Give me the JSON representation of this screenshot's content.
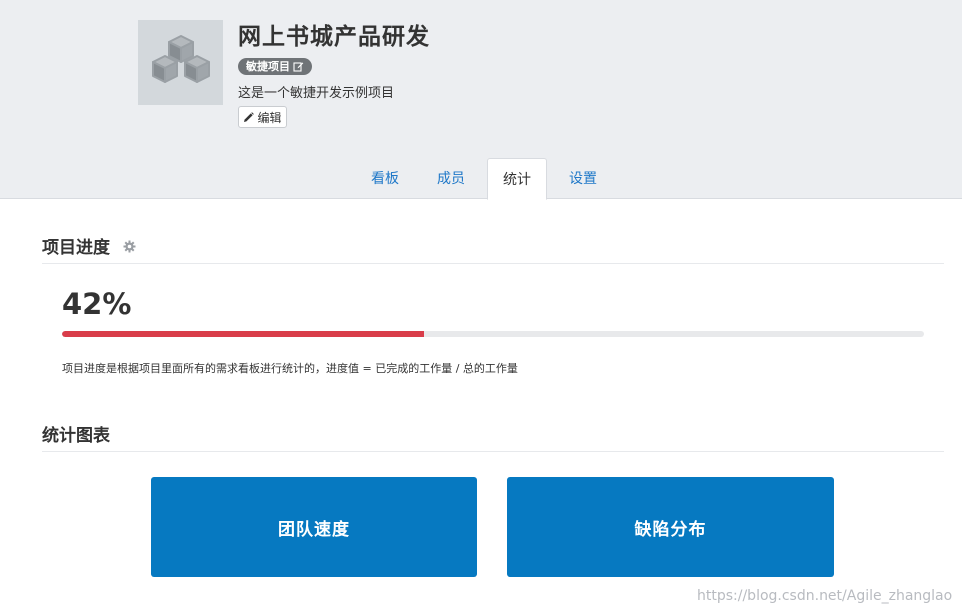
{
  "project": {
    "title": "网上书城产品研发",
    "type_badge": "敏捷项目",
    "description": "这是一个敏捷开发示例项目",
    "edit_label": "编辑",
    "icon": "cubes-icon"
  },
  "tabs": [
    {
      "label": "看板",
      "active": false
    },
    {
      "label": "成员",
      "active": false
    },
    {
      "label": "统计",
      "active": true
    },
    {
      "label": "设置",
      "active": false
    }
  ],
  "progress_section": {
    "title": "项目进度",
    "value_text": "42%",
    "fraction": 0.42,
    "note": "项目进度是根据项目里面所有的需求看板进行统计的，进度值 = 已完成的工作量 / 总的工作量",
    "bar_color": "#d93d4a"
  },
  "charts_section": {
    "title": "统计图表",
    "cards": [
      {
        "label": "团队速度"
      },
      {
        "label": "缺陷分布"
      }
    ],
    "card_color": "#0679c1"
  },
  "watermark": "https://blog.csdn.net/Agile_zhanglao",
  "colors": {
    "header_bg": "#eceef1",
    "link": "#1f78c8"
  }
}
